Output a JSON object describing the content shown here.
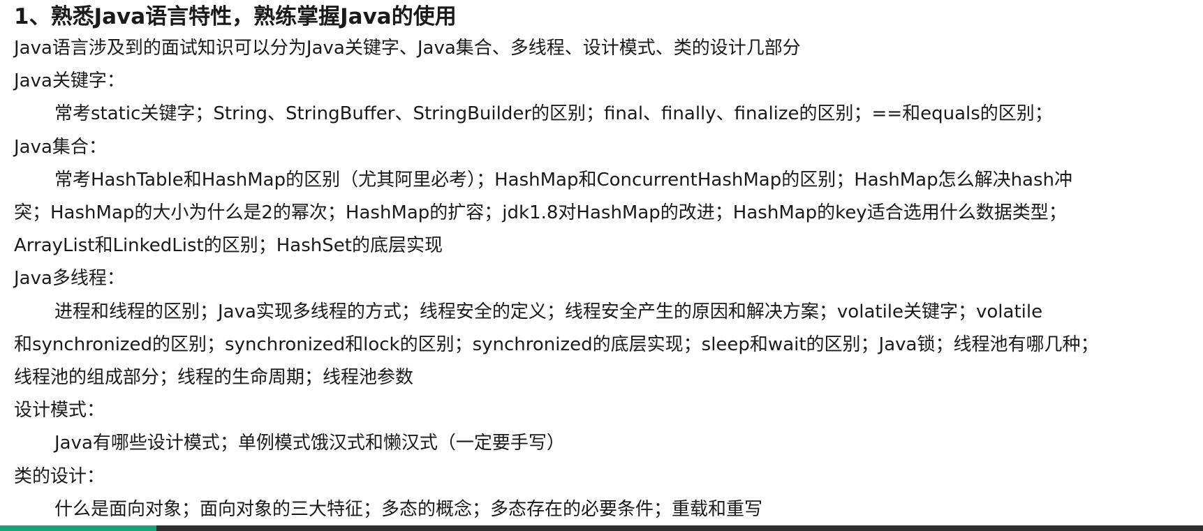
{
  "title": "1、熟悉Java语言特性，熟练掌握Java的使用",
  "intro": "Java语言涉及到的面试知识可以分为Java关键字、Java集合、多线程、设计模式、类的设计几部分",
  "sections": [
    {
      "heading": "Java关键字：",
      "lines": [
        "常考static关键字；String、StringBuffer、StringBuilder的区别；final、finally、finalize的区别；==和equals的区别；"
      ]
    },
    {
      "heading": "Java集合：",
      "lines": [
        "常考HashTable和HashMap的区别（尤其阿里必考）；HashMap和ConcurrentHashMap的区别；HashMap怎么解决hash冲",
        "突；HashMap的大小为什么是2的幂次；HashMap的扩容；jdk1.8对HashMap的改进；HashMap的key适合选用什么数据类型；",
        "ArrayList和LinkedList的区别；HashSet的底层实现"
      ]
    },
    {
      "heading": "Java多线程：",
      "lines": [
        "进程和线程的区别；Java实现多线程的方式；线程安全的定义；线程安全产生的原因和解决方案；volatile关键字；volatile",
        "和synchronized的区别；synchronized和lock的区别；synchronized的底层实现；sleep和wait的区别；Java锁；线程池有哪几种；",
        "线程池的组成部分；线程的生命周期；线程池参数"
      ]
    },
    {
      "heading": "设计模式：",
      "lines": [
        "Java有哪些设计模式；单例模式饿汉式和懒汉式（一定要手写）"
      ]
    },
    {
      "heading": "类的设计：",
      "lines": [
        "什么是面向对象；面向对象的三大特征；多态的概念；多态存在的必要条件；重载和重写"
      ]
    }
  ],
  "progress": {
    "fraction": 0.13,
    "color": "#1aa37a",
    "track_color": "#2e2e2e"
  }
}
